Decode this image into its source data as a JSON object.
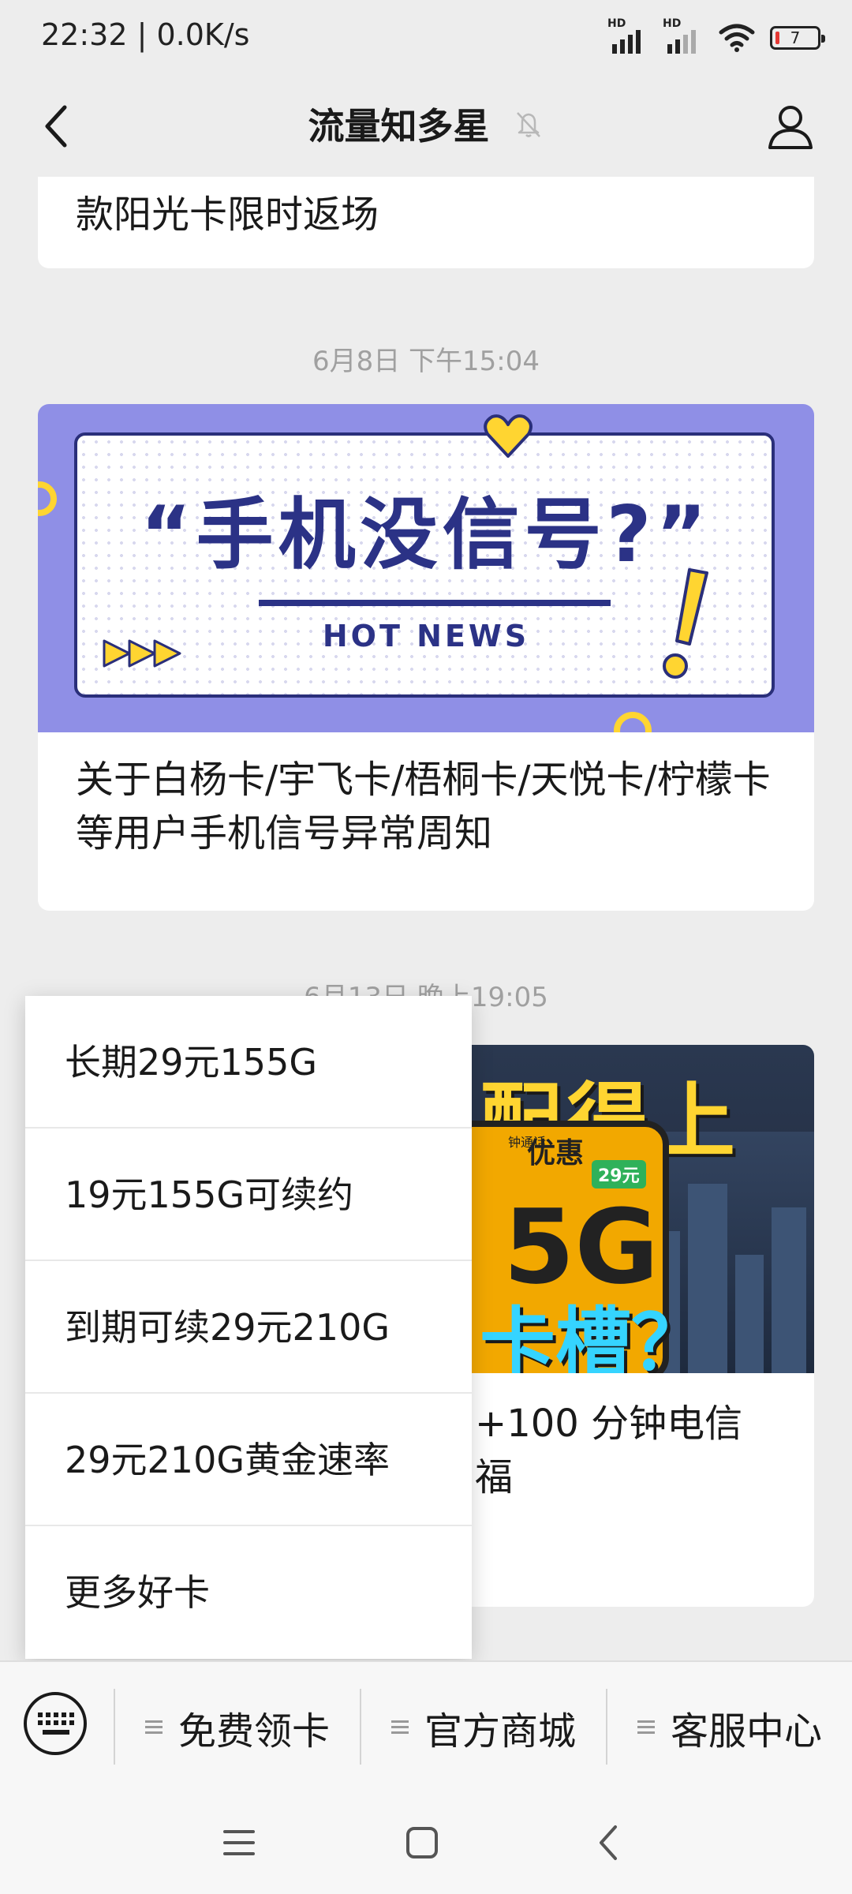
{
  "status_bar": {
    "time_speed": "22:32 | 0.0K/s",
    "signal_label_1": "HD",
    "signal_label_2": "HD",
    "battery_level": "7"
  },
  "header": {
    "title": "流量知多星",
    "icons": [
      "back-icon",
      "bell-muted-icon",
      "user-icon"
    ]
  },
  "feed": {
    "card_top_text": "款阳光卡限时返场",
    "timestamp_1": "6月8日 下午15:04",
    "banner_1": {
      "headline": "“手机没信号?”",
      "subtitle": "HOT NEWS"
    },
    "card_2_text": "关于白杨卡/宇飞卡/梧桐卡/天悦卡/柠檬卡等用户手机信号异常周知",
    "timestamp_2": "6月13日 晚上19:05",
    "banner_2": {
      "big_text": "配得上",
      "phone_tag": "优惠",
      "call_text": "钟通话",
      "price_tag": "29元",
      "speed_text": "5G",
      "slot_text": "卡槽？"
    },
    "card_3_text": "+100 分钟电信福"
  },
  "popup_menu": {
    "items": [
      "长期29元155G",
      "19元155G可续约",
      "到期可续29元210G",
      "29元210G黄金速率",
      "更多好卡"
    ]
  },
  "bottom_menu": {
    "items": [
      "免费领卡",
      "官方商城",
      "客服中心"
    ],
    "keyboard_icon": "keyboard-icon"
  },
  "nav_bar": {
    "icons": [
      "menu-icon",
      "home-icon",
      "back-icon"
    ]
  },
  "colors": {
    "background": "#ededed",
    "card": "#ffffff",
    "banner_purple": "#8f8fe6",
    "banner_navy": "#2b3286",
    "accent_yellow": "#ffd531"
  }
}
